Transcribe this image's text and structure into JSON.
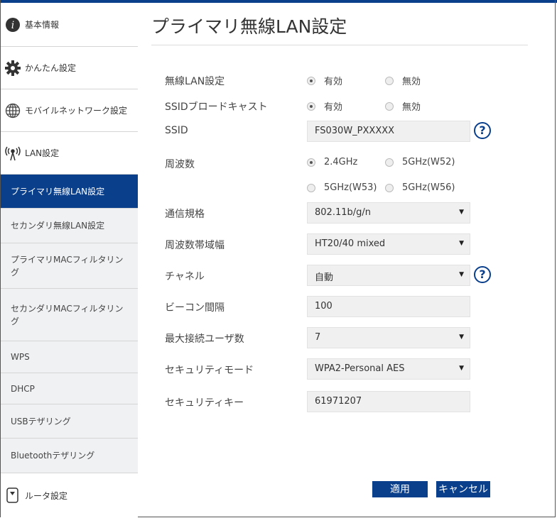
{
  "title": "プライマリ無線LAN設定",
  "sidebar": {
    "items": [
      {
        "label": "基本情報",
        "icon": "info-icon"
      },
      {
        "label": "かんたん設定",
        "icon": "gear-icon"
      },
      {
        "label": "モバイルネットワーク設定",
        "icon": "globe-icon"
      },
      {
        "label": "LAN設定",
        "icon": "antenna-icon"
      },
      {
        "label": "プライマリ無線LAN設定"
      },
      {
        "label": "セカンダリ無線LAN設定"
      },
      {
        "label": "プライマリMACフィルタリング"
      },
      {
        "label": "セカンダリMACフィルタリング"
      },
      {
        "label": "WPS"
      },
      {
        "label": "DHCP"
      },
      {
        "label": "USBテザリング"
      },
      {
        "label": "Bluetoothテザリング"
      },
      {
        "label": "ルータ設定",
        "icon": "router-icon"
      }
    ]
  },
  "form": {
    "wlan": {
      "label": "無線LAN設定",
      "opt1": "有効",
      "opt2": "無効",
      "selected": "有効"
    },
    "broadcast": {
      "label": "SSIDブロードキャスト",
      "opt1": "有効",
      "opt2": "無効",
      "selected": "有効"
    },
    "ssid": {
      "label": "SSID",
      "value": "FS030W_PXXXXX"
    },
    "freq": {
      "label": "周波数",
      "opt1": "2.4GHz",
      "opt2": "5GHz(W52)",
      "opt3": "5GHz(W53)",
      "opt4": "5GHz(W56)",
      "selected": "2.4GHz"
    },
    "standard": {
      "label": "通信規格",
      "value": "802.11b/g/n"
    },
    "bandwidth": {
      "label": "周波数帯域幅",
      "value": "HT20/40 mixed"
    },
    "channel": {
      "label": "チャネル",
      "value": "自動"
    },
    "beacon": {
      "label": "ビーコン間隔",
      "value": "100"
    },
    "maxusers": {
      "label": "最大接続ユーザ数",
      "value": "7"
    },
    "secmode": {
      "label": "セキュリティモード",
      "value": "WPA2-Personal AES"
    },
    "seckey": {
      "label": "セキュリティキー",
      "value": "61971207"
    }
  },
  "buttons": {
    "apply": "適用",
    "cancel": "キャンセル"
  },
  "help": "?",
  "colors": {
    "accent": "#0a3f8c"
  }
}
